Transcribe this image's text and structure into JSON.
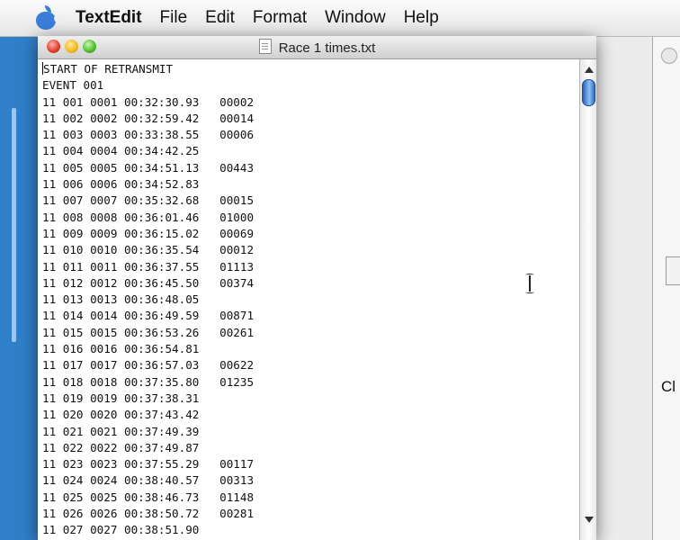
{
  "menubar": {
    "app_name": "TextEdit",
    "items": [
      "File",
      "Edit",
      "Format",
      "Window",
      "Help"
    ]
  },
  "window": {
    "title": "Race 1 times.txt"
  },
  "document": {
    "lines": [
      "START OF RETRANSMIT",
      "EVENT 001",
      "11 001 0001 00:32:30.93   00002",
      "11 002 0002 00:32:59.42   00014",
      "11 003 0003 00:33:38.55   00006",
      "11 004 0004 00:34:42.25",
      "11 005 0005 00:34:51.13   00443",
      "11 006 0006 00:34:52.83",
      "11 007 0007 00:35:32.68   00015",
      "11 008 0008 00:36:01.46   01000",
      "11 009 0009 00:36:15.02   00069",
      "11 010 0010 00:36:35.54   00012",
      "11 011 0011 00:36:37.55   01113",
      "11 012 0012 00:36:45.50   00374",
      "11 013 0013 00:36:48.05",
      "11 014 0014 00:36:49.59   00871",
      "11 015 0015 00:36:53.26   00261",
      "11 016 0016 00:36:54.81",
      "11 017 0017 00:36:57.03   00622",
      "11 018 0018 00:37:35.80   01235",
      "11 019 0019 00:37:38.31",
      "11 020 0020 00:37:43.42",
      "11 021 0021 00:37:49.39",
      "11 022 0022 00:37:49.87",
      "11 023 0023 00:37:55.29   00117",
      "11 024 0024 00:38:40.57   00313",
      "11 025 0025 00:38:46.73   01148",
      "11 026 0026 00:38:50.72   00281",
      "11 027 0027 00:38:51.90"
    ]
  },
  "background_window": {
    "visible_text": "Cl"
  },
  "icons": {
    "apple": "apple-menu-icon",
    "document": "document-icon",
    "cursor": "i-beam-cursor-icon"
  },
  "colors": {
    "desktop": "#2f7fc9",
    "scroll_thumb": "#4a8ee0"
  }
}
